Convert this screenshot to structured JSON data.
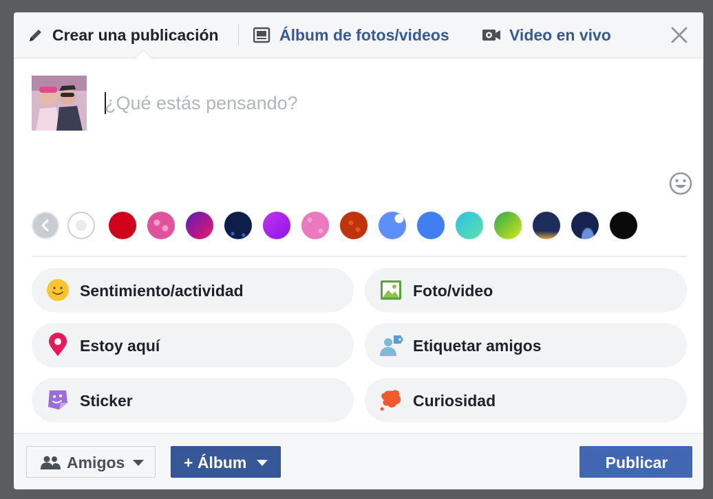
{
  "header": {
    "tabs": [
      {
        "label": "Crear una publicación",
        "icon": "pencil-icon"
      },
      {
        "label": "Álbum de fotos/videos",
        "icon": "photo-album-icon"
      },
      {
        "label": "Video en vivo",
        "icon": "video-camera-icon"
      }
    ],
    "close_icon": "close-icon"
  },
  "composer": {
    "value": "",
    "placeholder": "¿Qué estás pensando?",
    "emoji_icon": "smiley-icon"
  },
  "backgrounds": {
    "prev_icon": "chevron-left-icon",
    "swatches": [
      {
        "id": "white",
        "color": "#ffffff",
        "selected": true
      },
      {
        "id": "red",
        "color": "#d0021b"
      },
      {
        "id": "pink-hearts",
        "color": "#e0529c"
      },
      {
        "id": "purple-magenta",
        "color": "#b5179e"
      },
      {
        "id": "night-pattern",
        "color": "#0b1f4a"
      },
      {
        "id": "violet",
        "color": "#9b1de8"
      },
      {
        "id": "pink-pattern",
        "color": "#ea79be"
      },
      {
        "id": "red-pattern",
        "color": "#c0330b"
      },
      {
        "id": "blue-light",
        "color": "#5d8ff8"
      },
      {
        "id": "blue",
        "color": "#3f7ff2"
      },
      {
        "id": "teal-gradient",
        "color": "#3ad6c0"
      },
      {
        "id": "green-gradient",
        "color": "#7fd11a"
      },
      {
        "id": "navy-city",
        "color": "#1d2d5c"
      },
      {
        "id": "navy-wave",
        "color": "#14244f"
      },
      {
        "id": "black",
        "color": "#0a0a0a"
      }
    ]
  },
  "actions": [
    {
      "label": "Sentimiento/actividad",
      "icon": "smiley-face-icon"
    },
    {
      "label": "Foto/video",
      "icon": "photo-icon"
    },
    {
      "label": "Estoy aquí",
      "icon": "location-pin-icon"
    },
    {
      "label": "Etiquetar amigos",
      "icon": "tag-friends-icon"
    },
    {
      "label": "Sticker",
      "icon": "sticker-icon"
    },
    {
      "label": "Curiosidad",
      "icon": "splash-icon"
    }
  ],
  "footer": {
    "audience_label": "Amigos",
    "album_label": "+ Álbum",
    "publish_label": "Publicar"
  },
  "colors": {
    "brand_blue": "#4267b2",
    "link_blue": "#365899",
    "panel_bg": "#f5f6f7"
  }
}
